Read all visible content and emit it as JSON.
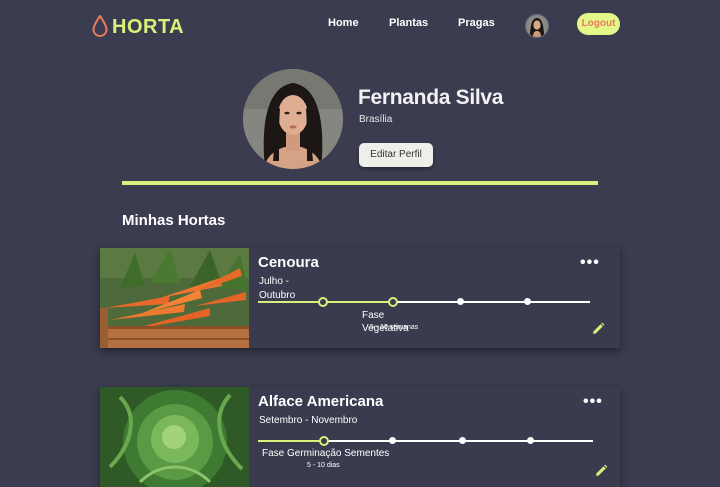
{
  "brand": {
    "name": "HORTA",
    "drop_color": "#e87a5d",
    "accent": "#d9f07a"
  },
  "nav": {
    "home": "Home",
    "plantas": "Plantas",
    "pragas": "Pragas",
    "logout": "Logout"
  },
  "profile": {
    "name": "Fernanda Silva",
    "city": "Brasília",
    "edit_label": "Editar Perfil"
  },
  "section": {
    "title": "Minhas Hortas"
  },
  "hortas": [
    {
      "name": "Cenoura",
      "period": "Julho - Outubro",
      "phase_label": "Fase Vegetativa",
      "phase_duration": "5 - 10 semanas",
      "stage_current": 2,
      "stage_total": 4
    },
    {
      "name": "Alface Americana",
      "period": "Setembro - Novembro",
      "phase_label": "Fase Germinação Sementes",
      "phase_duration": "5 - 10 dias",
      "stage_current": 1,
      "stage_total": 4
    }
  ],
  "icons": {
    "menu": "more-horizontal-icon",
    "edit": "pencil-icon",
    "logo": "drop-icon"
  }
}
